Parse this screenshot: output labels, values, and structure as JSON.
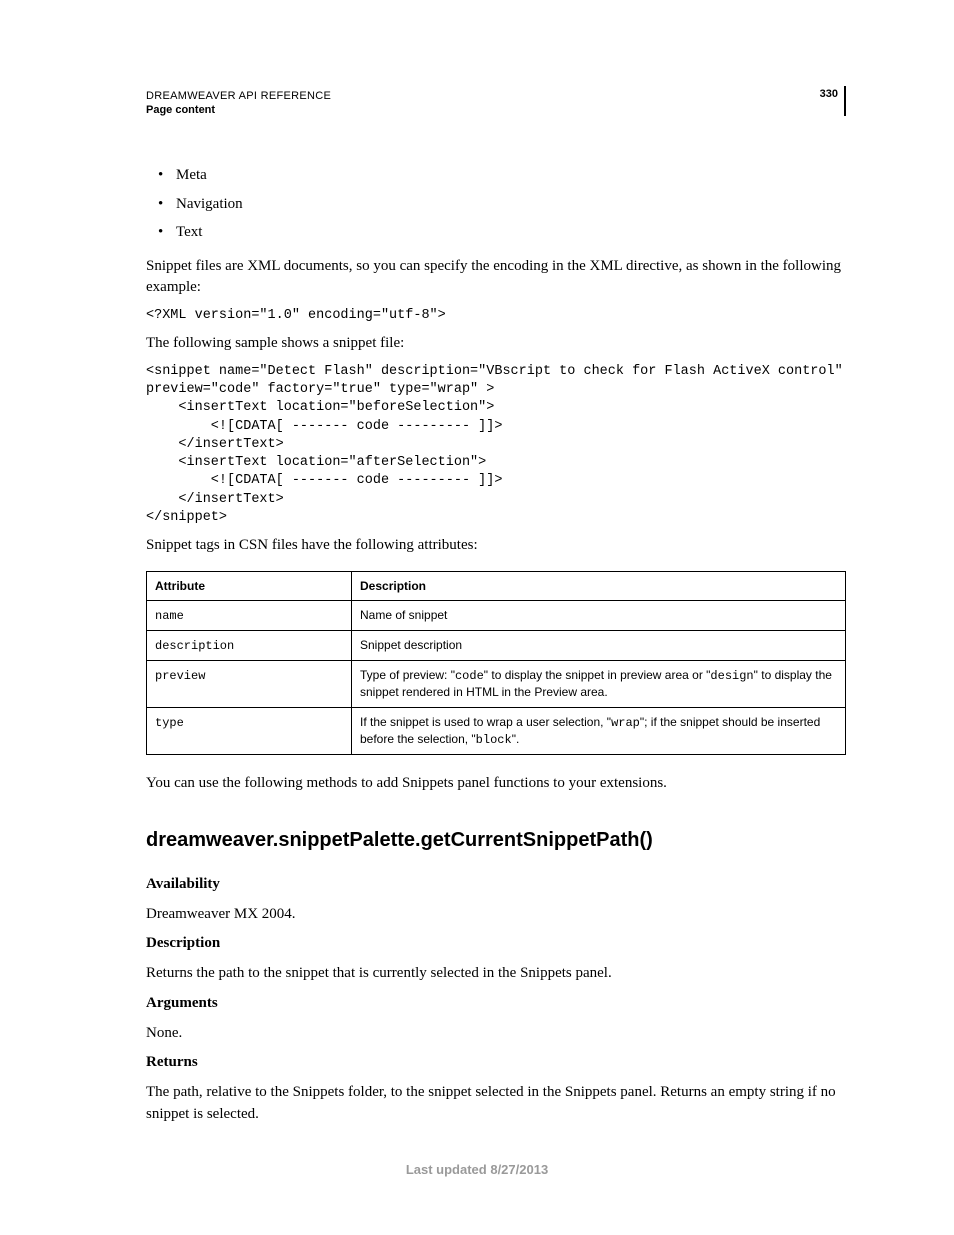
{
  "header": {
    "title": "DREAMWEAVER API REFERENCE",
    "section": "Page content",
    "page_number": "330"
  },
  "bullets": [
    "Meta",
    "Navigation",
    "Text"
  ],
  "para1": "Snippet files are XML documents, so you can specify the encoding in the XML directive, as shown in the following example:",
  "code1": "<?XML version=\"1.0\" encoding=\"utf-8\">",
  "para2": "The following sample shows a snippet file:",
  "code2": "<snippet name=\"Detect Flash\" description=\"VBscript to check for Flash ActiveX control\" \npreview=\"code\" factory=\"true\" type=\"wrap\" > \n    <insertText location=\"beforeSelection\"> \n        <![CDATA[ ------- code --------- ]]> \n    </insertText> \n    <insertText location=\"afterSelection\"> \n        <![CDATA[ ------- code --------- ]]> \n    </insertText> \n</snippet>",
  "para3": "Snippet tags in CSN files have the following attributes:",
  "table": {
    "headers": [
      "Attribute",
      "Description"
    ],
    "rows": [
      {
        "attr": "name",
        "desc_parts": [
          {
            "t": "Name of snippet"
          }
        ]
      },
      {
        "attr": "description",
        "desc_parts": [
          {
            "t": "Snippet description"
          }
        ]
      },
      {
        "attr": "preview",
        "desc_parts": [
          {
            "t": "Type of preview: \""
          },
          {
            "m": "code"
          },
          {
            "t": "\" to display the snippet in preview area or \""
          },
          {
            "m": "design"
          },
          {
            "t": "\" to display the snippet rendered in HTML in the Preview area."
          }
        ]
      },
      {
        "attr": "type",
        "desc_parts": [
          {
            "t": "If the snippet is used to wrap a user selection, \""
          },
          {
            "m": "wrap"
          },
          {
            "t": "\"; if the snippet should be inserted before the selection, \""
          },
          {
            "m": "block"
          },
          {
            "t": "\"."
          }
        ]
      }
    ]
  },
  "para4": "You can use the following methods to add Snippets panel functions to your extensions.",
  "api": {
    "heading": "dreamweaver.snippetPalette.getCurrentSnippetPath()",
    "availability_label": "Availability",
    "availability_text": "Dreamweaver MX 2004.",
    "description_label": "Description",
    "description_text": "Returns the path to the snippet that is currently selected in the Snippets panel.",
    "arguments_label": "Arguments",
    "arguments_text": "None.",
    "returns_label": "Returns",
    "returns_text": "The path, relative to the Snippets folder, to the snippet selected in the Snippets panel. Returns an empty string if no snippet is selected."
  },
  "footer": "Last updated 8/27/2013"
}
